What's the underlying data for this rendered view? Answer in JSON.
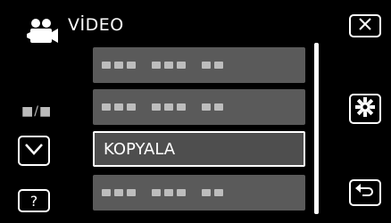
{
  "header": {
    "title": "VİDEO",
    "icon": "video-camera-icon"
  },
  "left": {
    "page_indicator": "■/■",
    "down_icon": "chevron-down-icon",
    "help_label": "?"
  },
  "right": {
    "close_icon": "close-icon",
    "settings_icon": "gear-icon",
    "back_icon": "return-icon"
  },
  "menu": {
    "items": [
      {
        "label": "",
        "placeholder": true
      },
      {
        "label": "",
        "placeholder": true
      },
      {
        "label": "KOPYALA",
        "selected": true
      },
      {
        "label": "",
        "placeholder": true
      }
    ]
  },
  "colors": {
    "background": "#000000",
    "item_bg": "#5a5a5a",
    "border": "#ffffff"
  }
}
